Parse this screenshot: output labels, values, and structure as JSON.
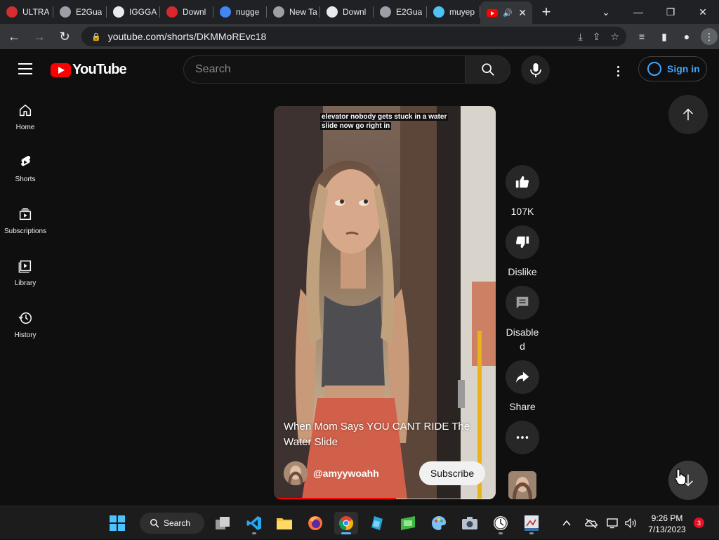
{
  "browser": {
    "tabs": [
      {
        "title": "ULTRA",
        "favicon": "red-app-icon",
        "color": "#d32f2f"
      },
      {
        "title": "E2Gua",
        "favicon": "globe-icon",
        "color": "#9aa0a6"
      },
      {
        "title": "IGGGA",
        "favicon": "iggga-icon",
        "color": "#e8eaed"
      },
      {
        "title": "Downl",
        "favicon": "mega-icon",
        "color": "#d9272e"
      },
      {
        "title": "nugge",
        "favicon": "google-icon",
        "color": "#4285f4"
      },
      {
        "title": "New Ta",
        "favicon": "chrome-icon",
        "color": "#9aa0a6"
      },
      {
        "title": "Downl",
        "favicon": "dor-icon",
        "color": "#e8eaed"
      },
      {
        "title": "E2Gua",
        "favicon": "globe-icon",
        "color": "#9aa0a6"
      },
      {
        "title": "muyep",
        "favicon": "muyep-icon",
        "color": "#4fc3f7"
      }
    ],
    "active_tab": {
      "favicon": "youtube-icon",
      "audio": "speaker-icon"
    },
    "url": "youtube.com/shorts/DKMMoREvc18"
  },
  "youtube": {
    "logo_text": "YouTube",
    "search_placeholder": "Search",
    "sign_in": "Sign in",
    "sidebar": [
      {
        "label": "Home",
        "icon": "home-icon"
      },
      {
        "label": "Shorts",
        "icon": "shorts-icon"
      },
      {
        "label": "Subscriptions",
        "icon": "subscriptions-icon"
      },
      {
        "label": "Library",
        "icon": "library-icon"
      },
      {
        "label": "History",
        "icon": "history-icon"
      }
    ],
    "short": {
      "caption_line1": "elevator nobody gets stuck in a water",
      "caption_line2": "slide now go right in",
      "title": "When Mom Says YOU CANT RIDE The Water Slide",
      "channel": "@amyywoahh",
      "subscribe": "Subscribe",
      "progress": 0.55
    },
    "actions": {
      "likes": "107K",
      "dislike": "Dislike",
      "comments": "Disabled",
      "share": "Share"
    }
  },
  "taskbar": {
    "search_label": "Search",
    "time": "9:26 PM",
    "date": "7/13/2023",
    "notifications": "3"
  }
}
